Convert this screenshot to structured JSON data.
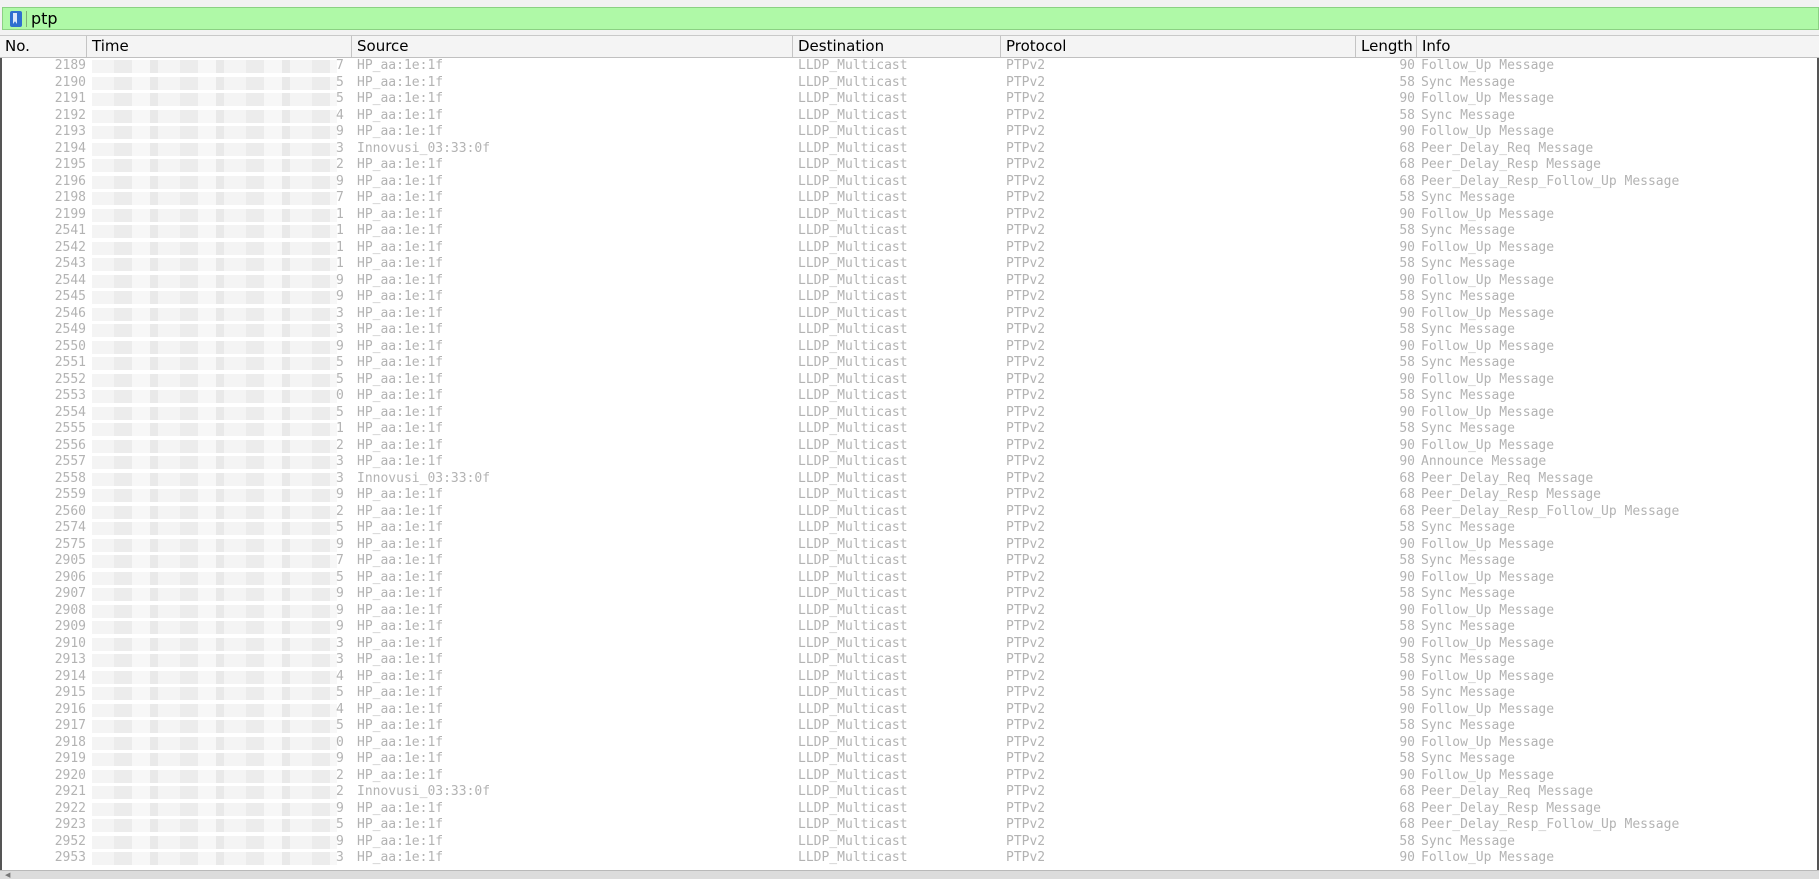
{
  "filter": {
    "text": "ptp",
    "bookmark_icon": "bookmark-icon"
  },
  "columns": {
    "no": "No.",
    "time": "Time",
    "source": "Source",
    "destination": "Destination",
    "protocol": "Protocol",
    "length": "Length",
    "info": "Info"
  },
  "packets": [
    {
      "no": "2189",
      "t": "7",
      "src": "HP_aa:1e:1f",
      "dst": "LLDP_Multicast",
      "proto": "PTPv2",
      "len": "90",
      "info": "Follow_Up Message"
    },
    {
      "no": "2190",
      "t": "5",
      "src": "HP_aa:1e:1f",
      "dst": "LLDP_Multicast",
      "proto": "PTPv2",
      "len": "58",
      "info": "Sync Message"
    },
    {
      "no": "2191",
      "t": "5",
      "src": "HP_aa:1e:1f",
      "dst": "LLDP_Multicast",
      "proto": "PTPv2",
      "len": "90",
      "info": "Follow_Up Message"
    },
    {
      "no": "2192",
      "t": "4",
      "src": "HP_aa:1e:1f",
      "dst": "LLDP_Multicast",
      "proto": "PTPv2",
      "len": "58",
      "info": "Sync Message"
    },
    {
      "no": "2193",
      "t": "9",
      "src": "HP_aa:1e:1f",
      "dst": "LLDP_Multicast",
      "proto": "PTPv2",
      "len": "90",
      "info": "Follow_Up Message"
    },
    {
      "no": "2194",
      "t": "3",
      "src": "Innovusi_03:33:0f",
      "dst": "LLDP_Multicast",
      "proto": "PTPv2",
      "len": "68",
      "info": "Peer_Delay_Req Message"
    },
    {
      "no": "2195",
      "t": "2",
      "src": "HP_aa:1e:1f",
      "dst": "LLDP_Multicast",
      "proto": "PTPv2",
      "len": "68",
      "info": "Peer_Delay_Resp Message"
    },
    {
      "no": "2196",
      "t": "9",
      "src": "HP_aa:1e:1f",
      "dst": "LLDP_Multicast",
      "proto": "PTPv2",
      "len": "68",
      "info": "Peer_Delay_Resp_Follow_Up Message"
    },
    {
      "no": "2198",
      "t": "7",
      "src": "HP_aa:1e:1f",
      "dst": "LLDP_Multicast",
      "proto": "PTPv2",
      "len": "58",
      "info": "Sync Message"
    },
    {
      "no": "2199",
      "t": "1",
      "src": "HP_aa:1e:1f",
      "dst": "LLDP_Multicast",
      "proto": "PTPv2",
      "len": "90",
      "info": "Follow_Up Message"
    },
    {
      "no": "2541",
      "t": "1",
      "src": "HP_aa:1e:1f",
      "dst": "LLDP_Multicast",
      "proto": "PTPv2",
      "len": "58",
      "info": "Sync Message"
    },
    {
      "no": "2542",
      "t": "1",
      "src": "HP_aa:1e:1f",
      "dst": "LLDP_Multicast",
      "proto": "PTPv2",
      "len": "90",
      "info": "Follow_Up Message"
    },
    {
      "no": "2543",
      "t": "1",
      "src": "HP_aa:1e:1f",
      "dst": "LLDP_Multicast",
      "proto": "PTPv2",
      "len": "58",
      "info": "Sync Message"
    },
    {
      "no": "2544",
      "t": "9",
      "src": "HP_aa:1e:1f",
      "dst": "LLDP_Multicast",
      "proto": "PTPv2",
      "len": "90",
      "info": "Follow_Up Message"
    },
    {
      "no": "2545",
      "t": "9",
      "src": "HP_aa:1e:1f",
      "dst": "LLDP_Multicast",
      "proto": "PTPv2",
      "len": "58",
      "info": "Sync Message"
    },
    {
      "no": "2546",
      "t": "3",
      "src": "HP_aa:1e:1f",
      "dst": "LLDP_Multicast",
      "proto": "PTPv2",
      "len": "90",
      "info": "Follow_Up Message"
    },
    {
      "no": "2549",
      "t": "3",
      "src": "HP_aa:1e:1f",
      "dst": "LLDP_Multicast",
      "proto": "PTPv2",
      "len": "58",
      "info": "Sync Message"
    },
    {
      "no": "2550",
      "t": "9",
      "src": "HP_aa:1e:1f",
      "dst": "LLDP_Multicast",
      "proto": "PTPv2",
      "len": "90",
      "info": "Follow_Up Message"
    },
    {
      "no": "2551",
      "t": "5",
      "src": "HP_aa:1e:1f",
      "dst": "LLDP_Multicast",
      "proto": "PTPv2",
      "len": "58",
      "info": "Sync Message"
    },
    {
      "no": "2552",
      "t": "5",
      "src": "HP_aa:1e:1f",
      "dst": "LLDP_Multicast",
      "proto": "PTPv2",
      "len": "90",
      "info": "Follow_Up Message"
    },
    {
      "no": "2553",
      "t": "0",
      "src": "HP_aa:1e:1f",
      "dst": "LLDP_Multicast",
      "proto": "PTPv2",
      "len": "58",
      "info": "Sync Message"
    },
    {
      "no": "2554",
      "t": "5",
      "src": "HP_aa:1e:1f",
      "dst": "LLDP_Multicast",
      "proto": "PTPv2",
      "len": "90",
      "info": "Follow_Up Message"
    },
    {
      "no": "2555",
      "t": "1",
      "src": "HP_aa:1e:1f",
      "dst": "LLDP_Multicast",
      "proto": "PTPv2",
      "len": "58",
      "info": "Sync Message"
    },
    {
      "no": "2556",
      "t": "2",
      "src": "HP_aa:1e:1f",
      "dst": "LLDP_Multicast",
      "proto": "PTPv2",
      "len": "90",
      "info": "Follow_Up Message"
    },
    {
      "no": "2557",
      "t": "3",
      "src": "HP_aa:1e:1f",
      "dst": "LLDP_Multicast",
      "proto": "PTPv2",
      "len": "90",
      "info": "Announce Message"
    },
    {
      "no": "2558",
      "t": "3",
      "src": "Innovusi_03:33:0f",
      "dst": "LLDP_Multicast",
      "proto": "PTPv2",
      "len": "68",
      "info": "Peer_Delay_Req Message"
    },
    {
      "no": "2559",
      "t": "9",
      "src": "HP_aa:1e:1f",
      "dst": "LLDP_Multicast",
      "proto": "PTPv2",
      "len": "68",
      "info": "Peer_Delay_Resp Message"
    },
    {
      "no": "2560",
      "t": "2",
      "src": "HP_aa:1e:1f",
      "dst": "LLDP_Multicast",
      "proto": "PTPv2",
      "len": "68",
      "info": "Peer_Delay_Resp_Follow_Up Message"
    },
    {
      "no": "2574",
      "t": "5",
      "src": "HP_aa:1e:1f",
      "dst": "LLDP_Multicast",
      "proto": "PTPv2",
      "len": "58",
      "info": "Sync Message"
    },
    {
      "no": "2575",
      "t": "9",
      "src": "HP_aa:1e:1f",
      "dst": "LLDP_Multicast",
      "proto": "PTPv2",
      "len": "90",
      "info": "Follow_Up Message"
    },
    {
      "no": "2905",
      "t": "7",
      "src": "HP_aa:1e:1f",
      "dst": "LLDP_Multicast",
      "proto": "PTPv2",
      "len": "58",
      "info": "Sync Message"
    },
    {
      "no": "2906",
      "t": "5",
      "src": "HP_aa:1e:1f",
      "dst": "LLDP_Multicast",
      "proto": "PTPv2",
      "len": "90",
      "info": "Follow_Up Message"
    },
    {
      "no": "2907",
      "t": "9",
      "src": "HP_aa:1e:1f",
      "dst": "LLDP_Multicast",
      "proto": "PTPv2",
      "len": "58",
      "info": "Sync Message"
    },
    {
      "no": "2908",
      "t": "9",
      "src": "HP_aa:1e:1f",
      "dst": "LLDP_Multicast",
      "proto": "PTPv2",
      "len": "90",
      "info": "Follow_Up Message"
    },
    {
      "no": "2909",
      "t": "9",
      "src": "HP_aa:1e:1f",
      "dst": "LLDP_Multicast",
      "proto": "PTPv2",
      "len": "58",
      "info": "Sync Message"
    },
    {
      "no": "2910",
      "t": "3",
      "src": "HP_aa:1e:1f",
      "dst": "LLDP_Multicast",
      "proto": "PTPv2",
      "len": "90",
      "info": "Follow_Up Message"
    },
    {
      "no": "2913",
      "t": "3",
      "src": "HP_aa:1e:1f",
      "dst": "LLDP_Multicast",
      "proto": "PTPv2",
      "len": "58",
      "info": "Sync Message"
    },
    {
      "no": "2914",
      "t": "4",
      "src": "HP_aa:1e:1f",
      "dst": "LLDP_Multicast",
      "proto": "PTPv2",
      "len": "90",
      "info": "Follow_Up Message"
    },
    {
      "no": "2915",
      "t": "5",
      "src": "HP_aa:1e:1f",
      "dst": "LLDP_Multicast",
      "proto": "PTPv2",
      "len": "58",
      "info": "Sync Message"
    },
    {
      "no": "2916",
      "t": "4",
      "src": "HP_aa:1e:1f",
      "dst": "LLDP_Multicast",
      "proto": "PTPv2",
      "len": "90",
      "info": "Follow_Up Message"
    },
    {
      "no": "2917",
      "t": "5",
      "src": "HP_aa:1e:1f",
      "dst": "LLDP_Multicast",
      "proto": "PTPv2",
      "len": "58",
      "info": "Sync Message"
    },
    {
      "no": "2918",
      "t": "0",
      "src": "HP_aa:1e:1f",
      "dst": "LLDP_Multicast",
      "proto": "PTPv2",
      "len": "90",
      "info": "Follow_Up Message"
    },
    {
      "no": "2919",
      "t": "9",
      "src": "HP_aa:1e:1f",
      "dst": "LLDP_Multicast",
      "proto": "PTPv2",
      "len": "58",
      "info": "Sync Message"
    },
    {
      "no": "2920",
      "t": "2",
      "src": "HP_aa:1e:1f",
      "dst": "LLDP_Multicast",
      "proto": "PTPv2",
      "len": "90",
      "info": "Follow_Up Message"
    },
    {
      "no": "2921",
      "t": "2",
      "src": "Innovusi_03:33:0f",
      "dst": "LLDP_Multicast",
      "proto": "PTPv2",
      "len": "68",
      "info": "Peer_Delay_Req Message"
    },
    {
      "no": "2922",
      "t": "9",
      "src": "HP_aa:1e:1f",
      "dst": "LLDP_Multicast",
      "proto": "PTPv2",
      "len": "68",
      "info": "Peer_Delay_Resp Message"
    },
    {
      "no": "2923",
      "t": "5",
      "src": "HP_aa:1e:1f",
      "dst": "LLDP_Multicast",
      "proto": "PTPv2",
      "len": "68",
      "info": "Peer_Delay_Resp_Follow_Up Message"
    },
    {
      "no": "2952",
      "t": "9",
      "src": "HP_aa:1e:1f",
      "dst": "LLDP_Multicast",
      "proto": "PTPv2",
      "len": "58",
      "info": "Sync Message"
    },
    {
      "no": "2953",
      "t": "3",
      "src": "HP_aa:1e:1f",
      "dst": "LLDP_Multicast",
      "proto": "PTPv2",
      "len": "90",
      "info": "Follow_Up Message"
    }
  ]
}
